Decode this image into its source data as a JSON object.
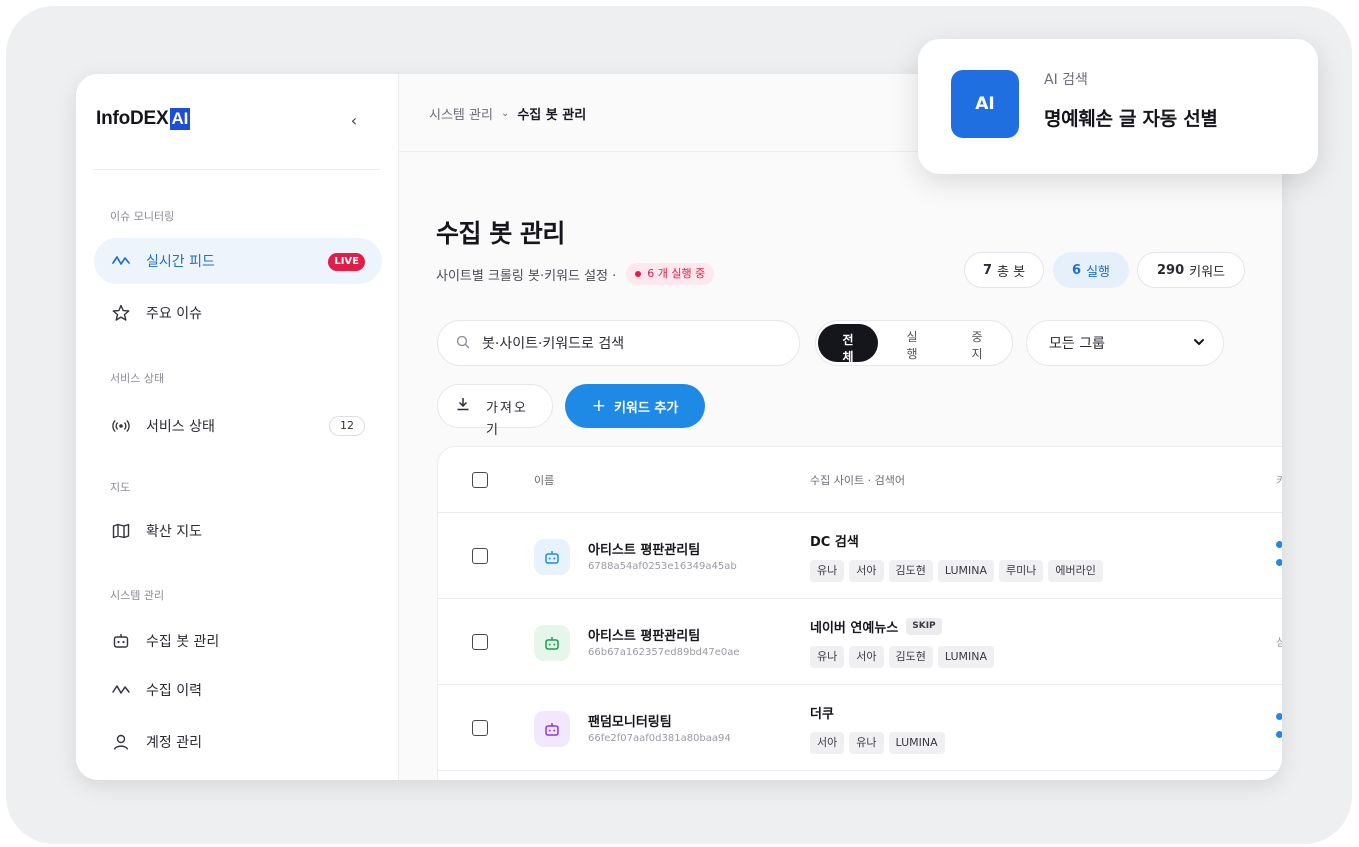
{
  "sidebar": {
    "logo_text": "InfoDEX",
    "logo_ai": "AI",
    "collapse_icon": "‹",
    "sections": [
      {
        "label": "이슈 모니터링"
      },
      {
        "label": "서비스 상태"
      },
      {
        "label": "지도"
      },
      {
        "label": "시스템 관리"
      }
    ],
    "items": [
      {
        "label": "실시간 피드",
        "icon": "pulse-icon",
        "badge": "LIVE"
      },
      {
        "label": "주요 이슈",
        "icon": "star-icon"
      },
      {
        "label": "서비스 상태",
        "icon": "broadcast-icon",
        "count": "12"
      },
      {
        "label": "확산 지도",
        "icon": "map-icon"
      },
      {
        "label": "수집 봇 관리",
        "icon": "bot-icon"
      },
      {
        "label": "수집 이력",
        "icon": "pulse-icon"
      },
      {
        "label": "계정 관리",
        "icon": "user-icon"
      }
    ]
  },
  "header": {
    "breadcrumb_parent": "시스템 관리",
    "breadcrumb_current": "수집 봇 관리"
  },
  "page": {
    "title": "수집 봇 관리",
    "subtitle": "사이트별 크롤링 봇·키워드 설정 ·",
    "running_label": "6 개 실행 중"
  },
  "stats": [
    {
      "value": "7",
      "label": "총 봇"
    },
    {
      "value": "6",
      "label": "실행"
    },
    {
      "value": "290",
      "label": "키워드"
    }
  ],
  "filters": {
    "search_placeholder": "봇·사이트·키워드로 검색",
    "segments": [
      "전체",
      "실행",
      "중지"
    ],
    "group_select": "모든 그룹"
  },
  "actions": {
    "import_label": "가져오기",
    "add_label": "키워드 추가"
  },
  "table": {
    "columns": [
      "이름",
      "수집 사이트 · 검색어"
    ],
    "rows": [
      {
        "name": "아티스트 평판관리팀",
        "id": "6788a54af0253e16349a45ab",
        "site": "DC 검색",
        "skip": "",
        "tags": [
          "유나",
          "서아",
          "김도현",
          "LUMINA",
          "루미나",
          "에버라인"
        ],
        "icon_color": "#1f8ae6",
        "icon_bg": "#e7f2fc"
      },
      {
        "name": "아티스트 평판관리팀",
        "id": "66b67a162357ed89bd47e0ae",
        "site": "네이버 연예뉴스",
        "skip": "SKIP",
        "tags": [
          "유나",
          "서아",
          "김도현",
          "LUMINA"
        ],
        "icon_color": "#16a34a",
        "icon_bg": "#e6f6ea"
      },
      {
        "name": "팬덤모니터링팀",
        "id": "66fe2f07aaf0d381a80baa94",
        "site": "더쿠",
        "skip": "",
        "tags": [
          "서아",
          "유나",
          "LUMINA"
        ],
        "icon_color": "#9333ea",
        "icon_bg": "#f1e8fb"
      }
    ]
  },
  "ai_card": {
    "badge": "AI",
    "label": "AI 검색",
    "title": "명예훼손 글 자동 선별"
  },
  "colors": {
    "accent": "#1f8ae6",
    "live": "#e11d48",
    "ai_badge": "#1f6fe0"
  }
}
